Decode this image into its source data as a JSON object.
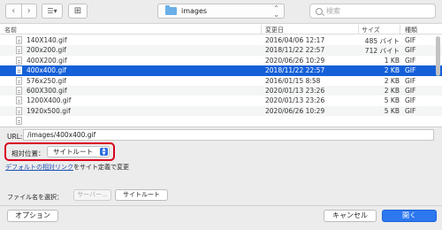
{
  "toolbar": {
    "back_icon": "‹",
    "forward_icon": "›",
    "view_icon": "☰▾",
    "new_folder_icon": "⊞",
    "folder_name": "images",
    "search_placeholder": "検索"
  },
  "columns": {
    "name": "名前",
    "modified": "変更日",
    "size": "サイズ",
    "kind": "種類"
  },
  "files": [
    {
      "name": "140X140.gif",
      "date": "2016/04/06 12:17",
      "size": "485 バイト",
      "kind": "GIF",
      "selected": false
    },
    {
      "name": "200x200.gif",
      "date": "2018/11/22 22:57",
      "size": "712 バイト",
      "kind": "GIF",
      "selected": false
    },
    {
      "name": "400X200.gif",
      "date": "2020/06/26 10:29",
      "size": "1 KB",
      "kind": "GIF",
      "selected": false
    },
    {
      "name": "400x400.gif",
      "date": "2018/11/22 22:57",
      "size": "2 KB",
      "kind": "GIF",
      "selected": true
    },
    {
      "name": "576x250.gif",
      "date": "2016/01/15 8:58",
      "size": "2 KB",
      "kind": "GIF",
      "selected": false
    },
    {
      "name": "600X300.gif",
      "date": "2020/01/13 23:26",
      "size": "2 KB",
      "kind": "GIF",
      "selected": false
    },
    {
      "name": "1200X400.gif",
      "date": "2020/01/13 23:26",
      "size": "5 KB",
      "kind": "GIF",
      "selected": false
    },
    {
      "name": "1920x500.gif",
      "date": "2020/06/26 10:29",
      "size": "5 KB",
      "kind": "GIF",
      "selected": false
    },
    {
      "name": "",
      "date": "",
      "size": "",
      "kind": "",
      "selected": false
    }
  ],
  "url": {
    "label": "URL:",
    "value": "/images/400x400.gif"
  },
  "relative": {
    "label": "相対位置：",
    "value": "サイトルート"
  },
  "default_link": {
    "link_text": "デフォルトの相対リンク",
    "rest": "をサイト定義で変更"
  },
  "filename": {
    "label": "ファイル名を選択：",
    "server_button": "サーバー...",
    "siteroot_button": "サイトルート"
  },
  "buttons": {
    "options": "オプション",
    "cancel": "キャンセル",
    "open": "開く"
  },
  "colors": {
    "selection": "#1560d8",
    "highlight_border": "#d8001f",
    "primary_button": "#2d77ef"
  }
}
